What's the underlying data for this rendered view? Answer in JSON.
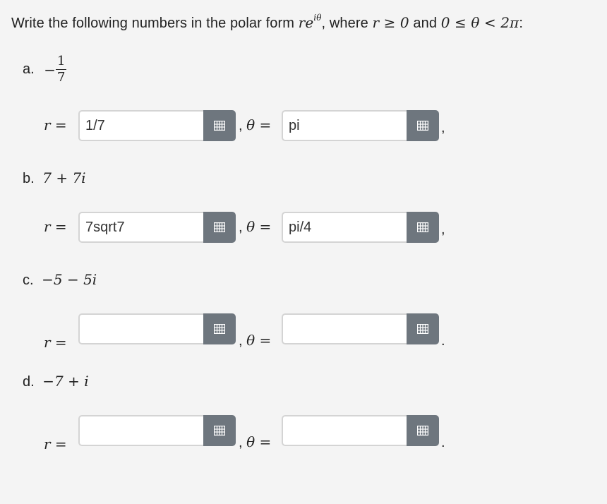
{
  "prompt": {
    "text1": "Write the following numbers in the polar form ",
    "form_r": "r",
    "form_e": "e",
    "form_sup": "iθ",
    "text2": ", where ",
    "cond1": "r ≥ 0",
    "text3": " and ",
    "cond2": "0 ≤ θ < 2π",
    "text4": ":"
  },
  "problems": [
    {
      "letter": "a.",
      "sign": "−",
      "numerator": "1",
      "denominator": "7",
      "r_label": "r =",
      "theta_label": "θ =",
      "r_value": "1/7",
      "theta_value": "pi",
      "end_punct": ","
    },
    {
      "letter": "b.",
      "expression": "7 + 7i",
      "r_label": "r =",
      "theta_label": "θ =",
      "r_value": "7sqrt7",
      "theta_value": "pi/4",
      "end_punct": ","
    },
    {
      "letter": "c.",
      "expression": "−5 − 5i",
      "r_label": "r =",
      "theta_label": "θ =",
      "r_value": "",
      "theta_value": "",
      "end_punct": "."
    },
    {
      "letter": "d.",
      "expression": "−7 + i",
      "r_label": "r =",
      "theta_label": "θ =",
      "r_value": "",
      "theta_value": "",
      "end_punct": "."
    }
  ],
  "comma": ",",
  "keypad_icon": "keypad-grid-icon",
  "colors": {
    "button": "#6e767e",
    "border": "#d4d4d4",
    "background": "#f4f4f4"
  }
}
